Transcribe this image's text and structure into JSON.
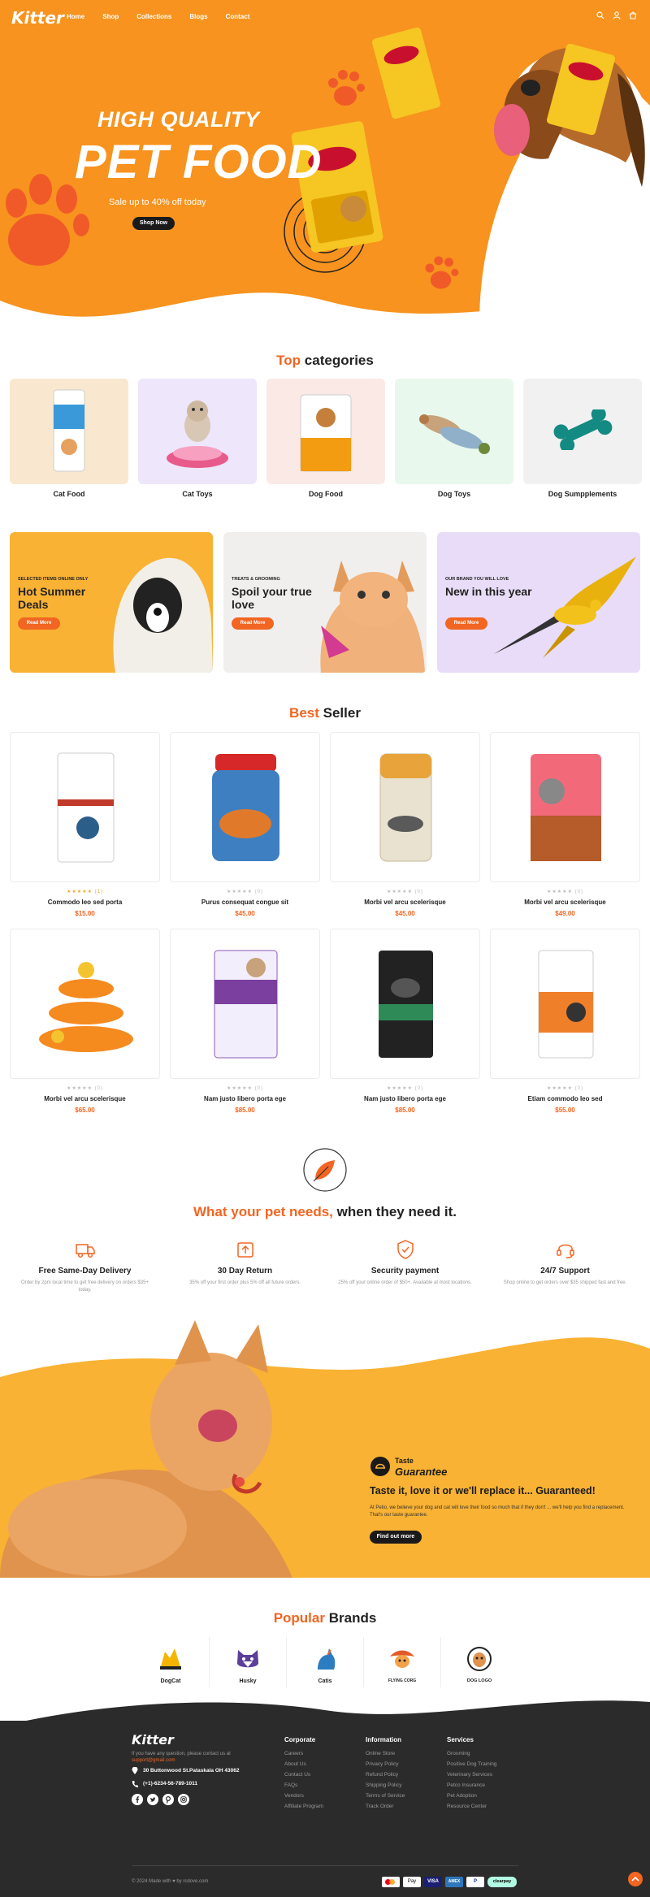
{
  "header": {
    "logo": "Kitter",
    "nav": [
      "Home",
      "Shop",
      "Collections",
      "Blogs",
      "Contact"
    ],
    "icons": [
      "search-icon",
      "user-icon",
      "cart-icon"
    ]
  },
  "hero": {
    "subtitle": "HIGH QUALITY",
    "title": "PET FOOD",
    "sale": "Sale up to 40% off today",
    "button": "Shop Now"
  },
  "top_categories": {
    "title_accent": "Top",
    "title_rest": "categories",
    "items": [
      {
        "label": "Cat Food",
        "bg": "#f9e8cf"
      },
      {
        "label": "Cat Toys",
        "bg": "#eee6fb"
      },
      {
        "label": "Dog Food",
        "bg": "#fbe9e6"
      },
      {
        "label": "Dog Toys",
        "bg": "#e9f8ec"
      },
      {
        "label": "Dog Sumpplements",
        "bg": "#f1f1f1"
      }
    ]
  },
  "promos": [
    {
      "small": "SELECTED ITEMS ONLINE ONLY",
      "big": "Hot Summer Deals",
      "button": "Read More",
      "bg": "#f9b233"
    },
    {
      "small": "TREATS & GROOMING",
      "big": "Spoil your true love",
      "button": "Read More",
      "bg": "#f1efee"
    },
    {
      "small": "OUR BRAND YOU WILL LOVE",
      "big": "New in this year",
      "button": "Read More",
      "bg": "#e8dcf8"
    }
  ],
  "best_seller": {
    "title_accent": "Best",
    "title_rest": "Seller",
    "products": [
      {
        "name": "Commodo leo sed porta",
        "price": "$15.00",
        "stars": "★★★★★ (1)",
        "rated": true
      },
      {
        "name": "Purus consequat congue sit",
        "price": "$45.00",
        "stars": "★★★★★ (0)",
        "rated": false
      },
      {
        "name": "Morbi vel arcu scelerisque",
        "price": "$45.00",
        "stars": "★★★★★ (0)",
        "rated": false
      },
      {
        "name": "Morbi vel arcu scelerisque",
        "price": "$49.00",
        "stars": "★★★★★ (0)",
        "rated": false
      },
      {
        "name": "Morbi vel arcu scelerisque",
        "price": "$65.00",
        "stars": "★★★★★ (0)",
        "rated": false
      },
      {
        "name": "Nam justo libero porta ege",
        "price": "$85.00",
        "stars": "★★★★★ (0)",
        "rated": false
      },
      {
        "name": "Nam justo libero porta ege",
        "price": "$85.00",
        "stars": "★★★★★ (0)",
        "rated": false
      },
      {
        "name": "Etiam commodo leo sed",
        "price": "$55.00",
        "stars": "★★★★★ (0)",
        "rated": false
      }
    ]
  },
  "needs": {
    "title_accent": "What your pet needs,",
    "title_rest": "when they need it.",
    "features": [
      {
        "title": "Free Same-Day Delivery",
        "desc": "Order by 2pm local time to get free delivery on orders $35+ today.",
        "icon": "truck-icon"
      },
      {
        "title": "30 Day Return",
        "desc": "35% off your first order plus 5% off all future orders.",
        "icon": "return-box-icon"
      },
      {
        "title": "Security payment",
        "desc": "25% off your online order of $50+. Available at most locations.",
        "icon": "shield-icon"
      },
      {
        "title": "24/7 Support",
        "desc": "Shop online to get orders over $35 shipped fast and free.",
        "icon": "headset-icon"
      }
    ]
  },
  "taste": {
    "badge_top": "Taste",
    "badge_bottom": "Guarantee",
    "headline": "Taste it, love it or we'll replace it... Guaranteed!",
    "body": "At Petio, we believe your dog and cat will love their food so much that if they don't ... we'll help you find a replacement. That's our taste guarantee.",
    "button": "Find out more"
  },
  "brands": {
    "title_accent": "Popular",
    "title_rest": "Brands",
    "items": [
      "DogCat",
      "Husky",
      "Catis",
      "FLYING CORG",
      "DOG LOGO"
    ]
  },
  "footer": {
    "logo": "Kitter",
    "intro": "If you have any question, please contact us at",
    "email": "support@gmail.com",
    "address": "30 Buttonwood St.Pataskala OH 43062",
    "phone": "(+1)-6234-56-789-1011",
    "social": [
      "facebook-icon",
      "twitter-icon",
      "pinterest-icon",
      "instagram-icon"
    ],
    "columns": [
      {
        "title": "Corporate",
        "links": [
          "Careers",
          "About Us",
          "Contact Us",
          "FAQs",
          "Vendors",
          "Affiliate Program"
        ]
      },
      {
        "title": "Information",
        "links": [
          "Online Store",
          "Privacy Policy",
          "Refund Policy",
          "Shipping Policy",
          "Terms of Service",
          "Track Order"
        ]
      },
      {
        "title": "Services",
        "links": [
          "Grooming",
          "Positive Dog Training",
          "Veterinary Services",
          "Petco Insurance",
          "Pet Adoption",
          "Resource Center"
        ]
      }
    ],
    "copyright": "© 2024 Made with ♥ by rcdove.com",
    "payments": [
      "mastercard",
      "Pay",
      "VISA",
      "AMEX",
      "P",
      "clearpay"
    ]
  },
  "colors": {
    "primary": "#f7931e",
    "accent": "#f26522",
    "dark": "#1a1a1a",
    "footer": "#2b2b2b"
  }
}
